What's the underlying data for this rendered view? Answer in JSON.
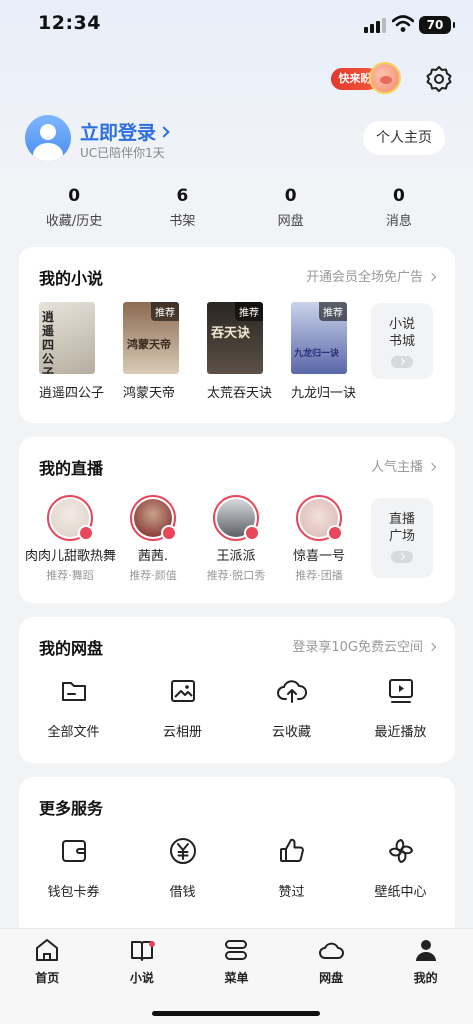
{
  "status_bar": {
    "time": "12:34",
    "battery": "70"
  },
  "promo": {
    "label": "快来盼"
  },
  "profile": {
    "login_label": "立即登录",
    "subtitle": "UC已陪伴你1天",
    "homepage_button": "个人主页"
  },
  "stats": [
    {
      "num": "0",
      "label": "收藏/历史"
    },
    {
      "num": "6",
      "label": "书架"
    },
    {
      "num": "0",
      "label": "网盘"
    },
    {
      "num": "0",
      "label": "消息"
    }
  ],
  "novels": {
    "title": "我的小说",
    "link": "开通会员全场免广告",
    "items": [
      {
        "name": "逍遥四公子",
        "tag": "",
        "cover_text": "逍遥四公子",
        "colors": [
          "#e7e3da",
          "#b6aea0"
        ]
      },
      {
        "name": "鸿蒙天帝",
        "tag": "推荐",
        "cover_text": "鸿蒙天帝",
        "colors": [
          "#8c6b52",
          "#d9cbb6"
        ]
      },
      {
        "name": "太荒吞天诀",
        "tag": "推荐",
        "cover_text": "吞天诀",
        "colors": [
          "#2a2622",
          "#5c5146"
        ]
      },
      {
        "name": "九龙归一诀",
        "tag": "推荐",
        "cover_text": "九龙归一诀",
        "colors": [
          "#c9d3ea",
          "#5a67a8"
        ]
      }
    ],
    "side": {
      "line1": "小说",
      "line2": "书城"
    }
  },
  "live": {
    "title": "我的直播",
    "link": "人气主播",
    "items": [
      {
        "name": "肉肉儿甜歌热舞",
        "sub": "推荐·舞蹈",
        "color": "#d9cfc6"
      },
      {
        "name": "茜茜.",
        "sub": "推荐·颜值",
        "color": "#7a1f22"
      },
      {
        "name": "王派派",
        "sub": "推荐·脱口秀",
        "color": "#9aa0a6"
      },
      {
        "name": "惊喜一号",
        "sub": "推荐·团播",
        "color": "#d8b6b0"
      }
    ],
    "side": {
      "line1": "直播",
      "line2": "广场"
    }
  },
  "netdisk": {
    "title": "我的网盘",
    "link": "登录享10G免费云空间",
    "items": [
      {
        "label": "全部文件",
        "icon": "folder-icon"
      },
      {
        "label": "云相册",
        "icon": "photo-icon"
      },
      {
        "label": "云收藏",
        "icon": "cloud-upload-icon"
      },
      {
        "label": "最近播放",
        "icon": "play-screen-icon"
      }
    ]
  },
  "services": {
    "title": "更多服务",
    "items": [
      {
        "label": "钱包卡券",
        "icon": "wallet-icon"
      },
      {
        "label": "借钱",
        "icon": "yen-icon"
      },
      {
        "label": "赞过",
        "icon": "thumb-up-icon"
      },
      {
        "label": "壁纸中心",
        "icon": "pinwheel-icon"
      }
    ]
  },
  "tabbar": [
    {
      "label": "首页",
      "icon": "home-icon"
    },
    {
      "label": "小说",
      "icon": "book-icon"
    },
    {
      "label": "菜单",
      "icon": "menu-icon"
    },
    {
      "label": "网盘",
      "icon": "cloud-icon"
    },
    {
      "label": "我的",
      "icon": "person-icon"
    }
  ],
  "colors": {
    "accent": "#2c6fe0",
    "live_ring": "#e8475b",
    "promo": "#e4372e"
  }
}
